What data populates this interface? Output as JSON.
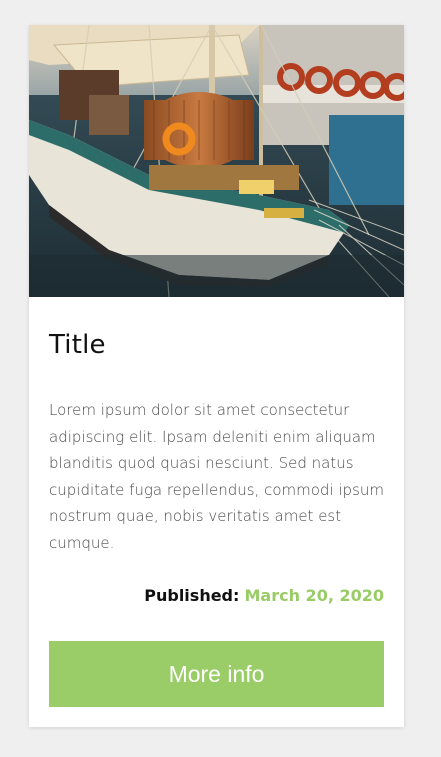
{
  "card": {
    "image_alt": "sailing boat in harbor",
    "title": "Title",
    "description": "Lorem ipsum dolor sit amet consectetur adipiscing elit. Ipsam deleniti enim aliquam blanditis quod quasi nesciunt. Sed natus cupiditate fuga repellendus, commodi ipsum nostrum quae, nobis veritatis amet est cumque.",
    "published_label": "Published:",
    "published_date": "March 20, 2020",
    "button_label": "More info"
  },
  "colors": {
    "accent": "#9acd68",
    "date": "#99cc66",
    "background": "#efefef",
    "card": "#ffffff"
  }
}
